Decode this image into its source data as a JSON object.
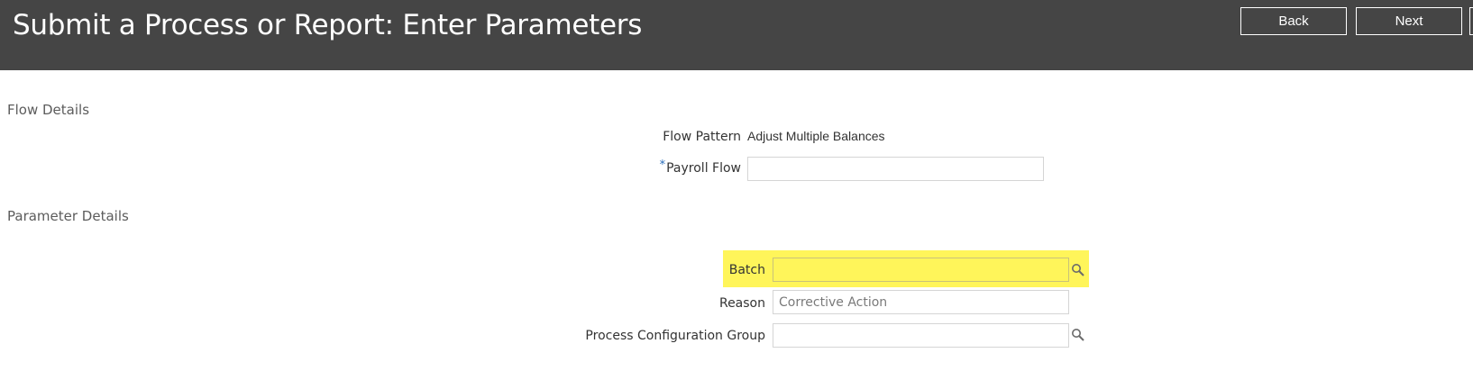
{
  "header": {
    "title": "Submit a Process or Report: Enter Parameters",
    "back_label": "Back",
    "next_label": "Next"
  },
  "flow_details": {
    "heading": "Flow Details",
    "flow_pattern_label": "Flow Pattern",
    "flow_pattern_value": "Adjust Multiple Balances",
    "payroll_flow_required_marker": "*",
    "payroll_flow_label": "Payroll Flow",
    "payroll_flow_value": ""
  },
  "parameter_details": {
    "heading": "Parameter Details",
    "batch_label": "Batch",
    "batch_value": "",
    "batch_icon": "search-icon",
    "reason_label": "Reason",
    "reason_placeholder": "Corrective Action",
    "process_config_group_label": "Process Configuration Group",
    "process_config_group_value": "",
    "process_config_group_icon": "search-icon"
  },
  "colors": {
    "header_bg": "#454545",
    "highlight": "#fff55a",
    "required_marker": "#2a6ebb"
  }
}
